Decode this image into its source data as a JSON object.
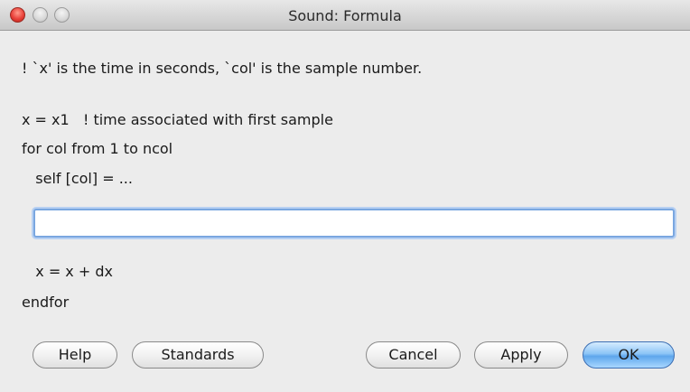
{
  "window": {
    "title": "Sound: Formula"
  },
  "formula": {
    "comment_line": "! `x' is the time in seconds, `col' is the sample number.",
    "line_x_init": "x = x1   ! time associated with first sample",
    "line_for": "for col from 1 to ncol",
    "line_self": "   self [col] = ...",
    "input_value": "",
    "line_x_step": "   x = x + dx",
    "line_endfor": "endfor"
  },
  "buttons": {
    "help": "Help",
    "standards": "Standards",
    "cancel": "Cancel",
    "apply": "Apply",
    "ok": "OK"
  },
  "colors": {
    "accent": "#5ea6ec",
    "close": "#e9413a"
  }
}
